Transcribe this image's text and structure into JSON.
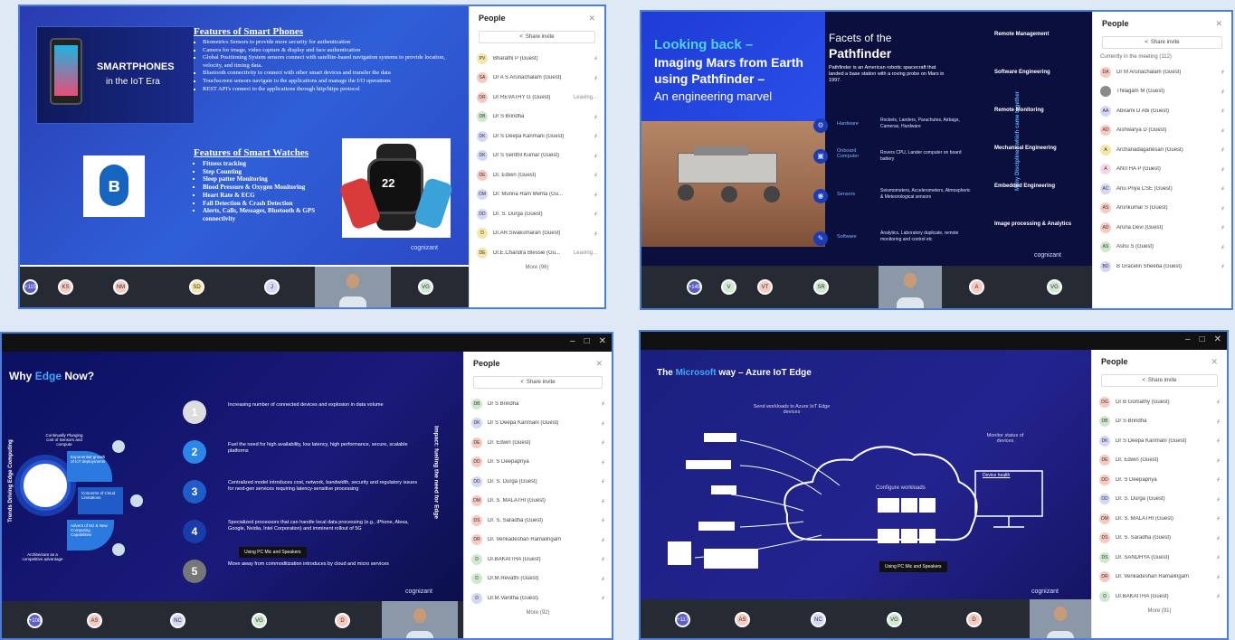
{
  "colors": {
    "accent": "#5b5fc7",
    "frame": "#4a7ed8"
  },
  "q1": {
    "smart_lines": [
      "SMARTPHONES",
      "in the IoT Era"
    ],
    "phones_title": "Features of Smart Phones",
    "phones_items": [
      "Biometrics Sensors to provide more security for authentication",
      "Camera for image, video capture & display and face authentication",
      "Global Positioning System sensors connect with satellite-based navigation systems to provide location, velocity, and timing data.",
      "Bluetooth connectivity to connect with other smart devices and transfer the data",
      "Touchscreen sensors navigate to the applications and manage the I/O operations",
      "REST API's connect to the applications through http/https protocol"
    ],
    "watches_title": "Features of Smart Watches",
    "watches_items": [
      "Fitness tracking",
      "Step Counting",
      "Sleep patter Monitoring",
      "Blood Pressure & Oxygen Monitoring",
      "Heart Rate & ECG",
      "Fall Detection & Crash Detection",
      "Alerts, Calls, Messages, Bluetooth & GPS connectivity"
    ],
    "watch_readout": "22",
    "brand": "cognizant",
    "people_title": "People",
    "share_label": "Share invite",
    "participants": [
      {
        "initials": "PV",
        "name": "Bharathi P (Guest)",
        "color": "#f4e6a6",
        "status": ""
      },
      {
        "initials": "SA",
        "name": "Dr A S Arunachalam (Guest)",
        "color": "#f6c9c1",
        "status": ""
      },
      {
        "initials": "DR",
        "name": "Dr REVATHY G (Guest)",
        "color": "#f6c9c1",
        "status": "Leaving..."
      },
      {
        "initials": "DB",
        "name": "Dr S Brindha",
        "color": "#cfe8cf",
        "status": ""
      },
      {
        "initials": "DK",
        "name": "Dr S Deepa Kanmani (Guest)",
        "color": "#d4d7f5",
        "status": ""
      },
      {
        "initials": "DK",
        "name": "Dr S Senthil Kumar (Guest)",
        "color": "#d4d7f5",
        "status": ""
      },
      {
        "initials": "DE",
        "name": "Dr. Edwin (Guest)",
        "color": "#f6c9c1",
        "status": ""
      },
      {
        "initials": "DM",
        "name": "Dr. Munna Ram Mehta (Gu...",
        "color": "#d4d7f5",
        "status": ""
      },
      {
        "initials": "DD",
        "name": "Dr. S. Durga (Guest)",
        "color": "#d4d7f5",
        "status": ""
      },
      {
        "initials": "D",
        "name": "Dr.AR.Sivakumaran (Guest)",
        "color": "#f4e6a6",
        "status": ""
      },
      {
        "initials": "DE",
        "name": "Dr.E.Chandra Blessie (Gu...",
        "color": "#f4e6a6",
        "status": "Leaving..."
      }
    ],
    "more": "More (96)",
    "bottom": [
      {
        "label": "+115",
        "type": "count"
      },
      {
        "label": "KS",
        "color": "#f6c9c1"
      },
      {
        "label": "NM",
        "color": "#f6c9c1"
      },
      {
        "label": "SD",
        "color": "#f4e6a6"
      },
      {
        "label": "J",
        "color": "#d4d7f5"
      },
      {
        "label": "VG",
        "color": "#cfe8cf"
      }
    ]
  },
  "q2": {
    "left_title_1": "Looking back –",
    "left_title_2": "Imaging Mars from Earth using Pathfinder –",
    "left_title_3": "An engineering marvel",
    "facets_1": "Facets of the",
    "facets_2": "Pathfinder",
    "facets_desc": "Pathfinder is an American robotic spacecraft that landed a base station with a roving probe on Mars in 1997.",
    "rows": [
      {
        "label": "Hardware",
        "text": "Rockets, Landers, Parachutes, Airbags, Cameras, Hardware"
      },
      {
        "label": "Onboard Computer",
        "text": "Rovers CPU, Lander computer on board battery"
      },
      {
        "label": "Sensors",
        "text": "Seismometers, Accelerometers, Atmospheric & Meteorological sensors"
      },
      {
        "label": "Software",
        "text": "Analytics, Laboratory duplicate, remote monitoring and control etc"
      }
    ],
    "vertical": "Many Disciplines which came together",
    "disciplines": [
      "Remote Management",
      "Software Engineering",
      "Remote Monitoring",
      "Mechanical Engineering",
      "Embedded Engineering",
      "Image processing & Analytics"
    ],
    "brand": "cognizant",
    "people_title": "People",
    "share_label": "Share invite",
    "in_meeting": "Currently in the meeting (112)",
    "participants": [
      {
        "initials": "DA",
        "name": "Dr M Arunachalam (Guest)",
        "color": "#f6c9c1"
      },
      {
        "initials": "",
        "name": "Thilagam M (Guest)",
        "color": "#8b8b8b"
      },
      {
        "initials": "AA",
        "name": "Abirami D Abi (Guest)",
        "color": "#d4d7f5"
      },
      {
        "initials": "AD",
        "name": "Aishwarya D (Guest)",
        "color": "#f6c9c1"
      },
      {
        "initials": "A",
        "name": "Archanadaganesan (Guest)",
        "color": "#f4e6a6"
      },
      {
        "initials": "A",
        "name": "ANITHA P (Guest)",
        "color": "#f6d4ea"
      },
      {
        "initials": "AC",
        "name": "Anu Priya CSE (Guest)",
        "color": "#d4d7f5"
      },
      {
        "initials": "AS",
        "name": "Arunkumar S (Guest)",
        "color": "#f6c9c1"
      },
      {
        "initials": "AD",
        "name": "Aruna Devi (Guest)",
        "color": "#f6c9c1"
      },
      {
        "initials": "AS",
        "name": "Ashu S (Guest)",
        "color": "#cfe8cf"
      },
      {
        "initials": "BD",
        "name": "B Gracelin Sheeba (Guest)",
        "color": "#d4d7f5"
      }
    ],
    "bottom": [
      {
        "label": "+149",
        "type": "count"
      },
      {
        "label": "V",
        "color": "#cfe8cf"
      },
      {
        "label": "VT",
        "color": "#f6c9c1"
      },
      {
        "label": "SR",
        "color": "#cfe8cf"
      },
      {
        "label": "A",
        "color": "#f6c9c1"
      },
      {
        "label": "VG",
        "color": "#cfe8cf"
      }
    ]
  },
  "q3": {
    "title_1": "Why",
    "title_edge": "Edge",
    "title_2": "Now?",
    "left_vertical": "Trends Driving Edge Computing",
    "right_vertical": "Impact: fueling the need for Edge",
    "segments": [
      "Continually Plunging cost of Sensors and compute",
      "Exponential growth of IoT deployments",
      "Concerns of Cloud Limitations",
      "Advent of 5G & New Computing Capabilities",
      "Architecture as a competitive advantage"
    ],
    "items": [
      {
        "num": "1",
        "text": "Increasing number of connected devices and explosion in data volume"
      },
      {
        "num": "2",
        "text": "Fuel the need for high availability, low latency, high performance, secure, scalable platforms"
      },
      {
        "num": "3",
        "text": "Centralized model introduces cost, network, bandwidth, security and regulatory issues for next-gen services requiring latency-sensitive processing"
      },
      {
        "num": "4",
        "text": "Specialized processors that can handle local data processing (e.g., iPhone, Alexa, Google, Nvidia, Intel Corporation) and imminent rollout of 5G"
      },
      {
        "num": "5",
        "text": "Move away from commoditization introduces by cloud and micro services"
      }
    ],
    "tooltip": "Using PC Mic and Speakers",
    "brand": "cognizant",
    "people_title": "People",
    "share_label": "Share invite",
    "participants": [
      {
        "initials": "DB",
        "name": "Dr S Brindha",
        "color": "#cfe8cf"
      },
      {
        "initials": "DK",
        "name": "Dr S Deepa Kanmani (Guest)",
        "color": "#d4d7f5"
      },
      {
        "initials": "DE",
        "name": "Dr. Edwin (Guest)",
        "color": "#f6c9c1"
      },
      {
        "initials": "DD",
        "name": "Dr. S Deepapriya",
        "color": "#f6c9c1"
      },
      {
        "initials": "DD",
        "name": "Dr. S. Durga (Guest)",
        "color": "#d4d7f5"
      },
      {
        "initials": "DM",
        "name": "Dr. S. MALATHI (Guest)",
        "color": "#f6c9c1"
      },
      {
        "initials": "DS",
        "name": "Dr. S. Saradha (Guest)",
        "color": "#f6c9c1"
      },
      {
        "initials": "DR",
        "name": "Dr. Venkadeshan Ramalingam",
        "color": "#f6c9c1"
      },
      {
        "initials": "D",
        "name": "Dr.BAKAITHA (Guest)",
        "color": "#cfe8cf"
      },
      {
        "initials": "D",
        "name": "Dr.M.Revathi (Guest)",
        "color": "#cfe8cf"
      },
      {
        "initials": "D",
        "name": "Dr.M.Vanitha (Guest)",
        "color": "#d4d7f5"
      }
    ],
    "more": "More (92)",
    "bottom": [
      {
        "label": "+108",
        "type": "count"
      },
      {
        "label": "AS",
        "color": "#f6c9c1"
      },
      {
        "label": "NC",
        "color": "#d4d7f5"
      },
      {
        "label": "VG",
        "color": "#cfe8cf"
      },
      {
        "label": "D",
        "color": "#f6c9c1"
      }
    ]
  },
  "q4": {
    "title_1": "The",
    "title_ms": "Microsoft",
    "title_2": "way – Azure IoT Edge",
    "send": "Send workloads to Azure IoT Edge devices",
    "monitor": "Monitor status of devices",
    "configure": "Configure workloads",
    "device_health": "Device health",
    "tooltip": "Using PC Mic and Speakers",
    "brand": "cognizant",
    "people_title": "People",
    "share_label": "Share invite",
    "participants": [
      {
        "initials": "DG",
        "name": "Dr B Gomathy (Guest)",
        "color": "#f6c9c1"
      },
      {
        "initials": "DB",
        "name": "Dr S Brindha",
        "color": "#cfe8cf"
      },
      {
        "initials": "DK",
        "name": "Dr S Deepa Kanmani (Guest)",
        "color": "#d4d7f5"
      },
      {
        "initials": "DE",
        "name": "Dr. Edwin (Guest)",
        "color": "#f6c9c1"
      },
      {
        "initials": "DD",
        "name": "Dr. S Deepapriya",
        "color": "#f6c9c1"
      },
      {
        "initials": "DD",
        "name": "Dr. S. Durga (Guest)",
        "color": "#d4d7f5"
      },
      {
        "initials": "DM",
        "name": "Dr. S. MALATHI (Guest)",
        "color": "#f6c9c1"
      },
      {
        "initials": "DS",
        "name": "Dr. S. Saradha (Guest)",
        "color": "#f6c9c1"
      },
      {
        "initials": "DS",
        "name": "Dr. SANDHYA (Guest)",
        "color": "#cfe8cf"
      },
      {
        "initials": "DR",
        "name": "Dr. Venkadeshan Ramalingam",
        "color": "#f6c9c1"
      },
      {
        "initials": "D",
        "name": "Dr.BAKAITHA (Guest)",
        "color": "#cfe8cf"
      }
    ],
    "more": "More (91)",
    "bottom": [
      {
        "label": "+117",
        "type": "count"
      },
      {
        "label": "AS",
        "color": "#f6c9c1"
      },
      {
        "label": "NC",
        "color": "#d4d7f5"
      },
      {
        "label": "VG",
        "color": "#cfe8cf"
      },
      {
        "label": "D",
        "color": "#f6c9c1"
      }
    ]
  }
}
